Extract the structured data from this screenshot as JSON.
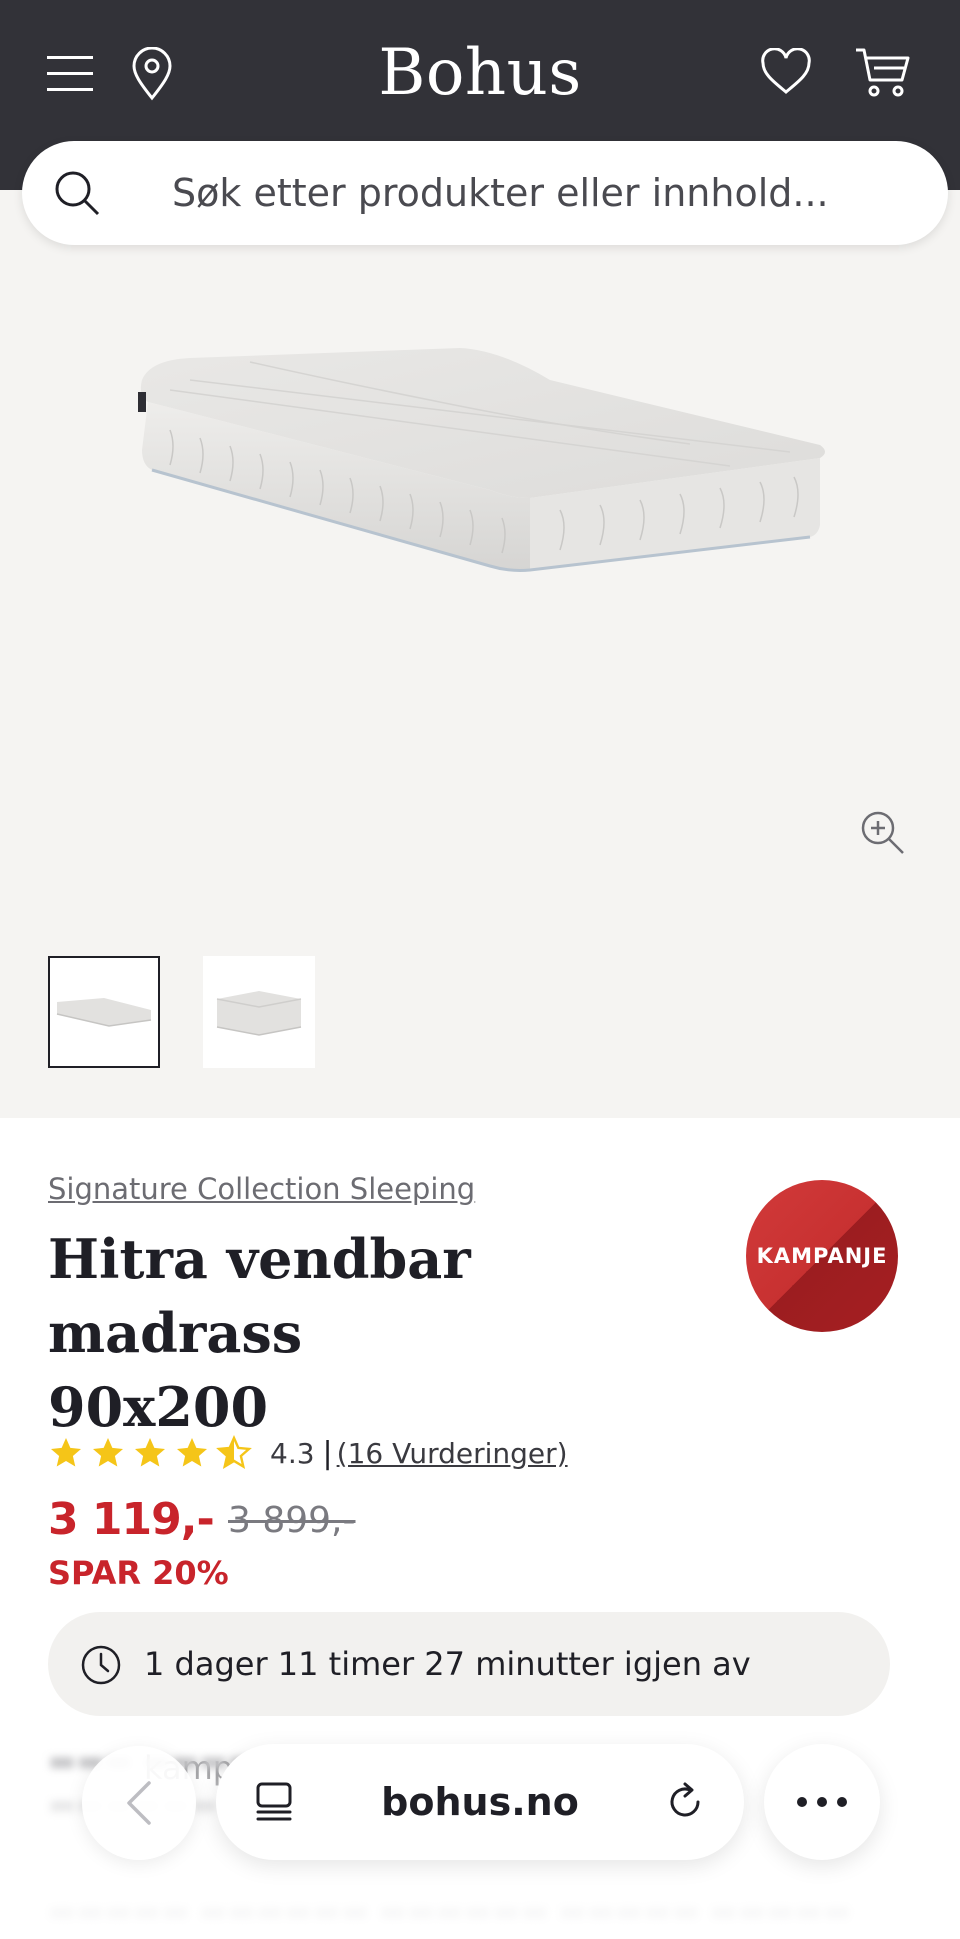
{
  "header": {
    "logo": "Bohus",
    "icons": [
      "menu-icon",
      "location-pin-icon",
      "heart-icon",
      "cart-icon"
    ],
    "background": "#323238"
  },
  "search": {
    "placeholder": "Søk etter produkter eller innhold..."
  },
  "gallery": {
    "main_image": "mattress-image",
    "thumbnails": [
      "mattress-thumb-1",
      "mattress-thumb-2"
    ],
    "active_thumbnail": 1
  },
  "product": {
    "brand": "Signature Collection Sleeping",
    "title_line1": "Hitra vendbar madrass",
    "title_line2": "90x200",
    "badge": "KAMPANJE",
    "rating": 4.3,
    "rating_text": "4.3",
    "rating_separator": "|",
    "reviews": "(16 Vurderinger)",
    "price": "3 119,-",
    "old_price": "3 899,-",
    "save": "SPAR 20%",
    "countdown": "1 dager 11 timer 27 minutter igjen av kampanjen"
  },
  "colors": {
    "sale_red": "#c8242b",
    "star_yellow": "#f5c518"
  },
  "browser": {
    "url": "bohus.no",
    "icons": [
      "back-icon",
      "tabs-icon",
      "reload-icon",
      "more-icon"
    ]
  }
}
